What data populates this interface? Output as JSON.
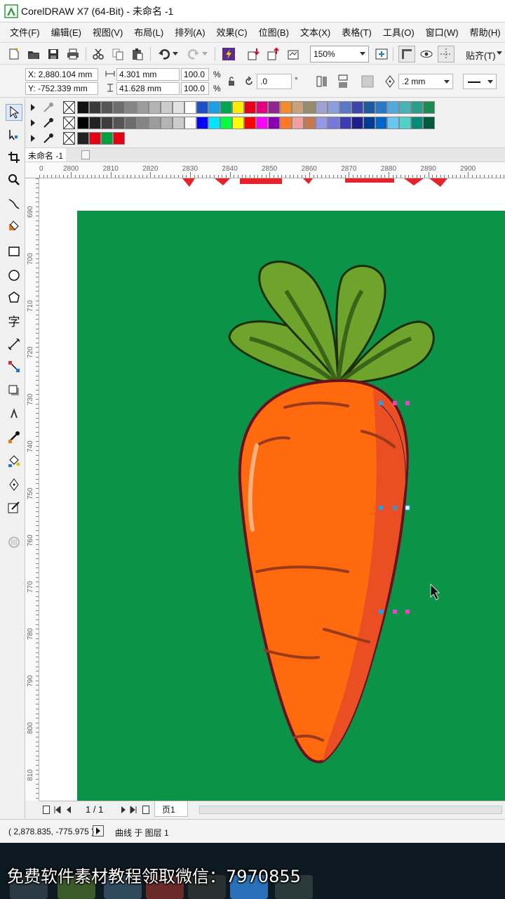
{
  "app": {
    "title": "CorelDRAW X7 (64-Bit) - 未命名 -1",
    "logo_icon": "coreldraw-logo-icon"
  },
  "menu": {
    "items": [
      "文件(F)",
      "编辑(E)",
      "视图(V)",
      "布局(L)",
      "排列(A)",
      "效果(C)",
      "位图(B)",
      "文本(X)",
      "表格(T)",
      "工具(O)",
      "窗口(W)",
      "帮助(H)"
    ]
  },
  "toolbar": {
    "zoom_value": "150%",
    "snap_label": "贴齐(T)"
  },
  "propbar": {
    "x_value": "X: 2,880.104 mm",
    "y_value": "Y: -752.339 mm",
    "width_value": "4.301 mm",
    "height_value": "41.628 mm",
    "scale_x": "100.0",
    "scale_y": "100.0",
    "pct_symbol": "%",
    "rotation_value": ".0",
    "degree_symbol": "°",
    "outline_width": ".2 mm"
  },
  "palette": {
    "row1": [
      "#111111",
      "#3a3a3a",
      "#555555",
      "#6d6d6d",
      "#858585",
      "#9c9c9c",
      "#b4b4b4",
      "#cccccc",
      "#e2e2e2",
      "#ffffff",
      "#1e50c8",
      "#1aa0e6",
      "#00a650",
      "#ffed00",
      "#e6001e",
      "#e4007f",
      "#8e2890",
      "#f28c28",
      "#c8a07a",
      "#958c6e",
      "#a0a0d2",
      "#8aa0dc",
      "#5a78c8",
      "#3c46aa",
      "#1e5aa0",
      "#2878c8",
      "#50aadc",
      "#46b4b4",
      "#28a08c",
      "#1e8c50"
    ],
    "row2": [
      "#000000",
      "#232323",
      "#3c3c3c",
      "#545454",
      "#6c6c6c",
      "#848484",
      "#9c9c9c",
      "#b4b4b4",
      "#cccccc",
      "#fafafa",
      "#0000ff",
      "#00e6ff",
      "#00ff3c",
      "#ffff00",
      "#ff0000",
      "#ff00ff",
      "#8c00b4",
      "#ff7828",
      "#f0a0a0",
      "#c87850",
      "#9696e6",
      "#7878dc",
      "#3c3cb4",
      "#1e1e8c",
      "#003c96",
      "#0064c8",
      "#64c8f0",
      "#50d2c8",
      "#008c78",
      "#005a3c"
    ],
    "row3": [
      "#222222",
      "#e60012",
      "#00a040",
      "#e60012"
    ]
  },
  "document": {
    "tab_label": "未命名 -1"
  },
  "ruler": {
    "h_labels": [
      "2800",
      "2810",
      "2820",
      "2830",
      "2840",
      "2850",
      "2860",
      "2870",
      "2880",
      "2890",
      "2900"
    ],
    "h_first": "0",
    "v_labels": [
      "690",
      "700",
      "710",
      "720",
      "730",
      "740",
      "750",
      "760",
      "770",
      "780",
      "790",
      "800",
      "810"
    ]
  },
  "pagenav": {
    "page_count": "1 / 1",
    "page_tab": "页1"
  },
  "status": {
    "coords": "( 2,878.835, -775.975 )",
    "message": "曲线 于 图层 1"
  },
  "overlay": {
    "watermark": "免费软件素材教程领取微信：7970855"
  },
  "colors": {
    "canvas_green": "#0b9447",
    "carrot_orange": "#ff6a0e",
    "carrot_shade": "#ea4e22",
    "carrot_outline": "#6a1020",
    "leaf_light": "#6ea42c",
    "leaf_dark": "#3a6418",
    "node_blue": "#1ea0f0",
    "node_pink": "#f040c8"
  }
}
